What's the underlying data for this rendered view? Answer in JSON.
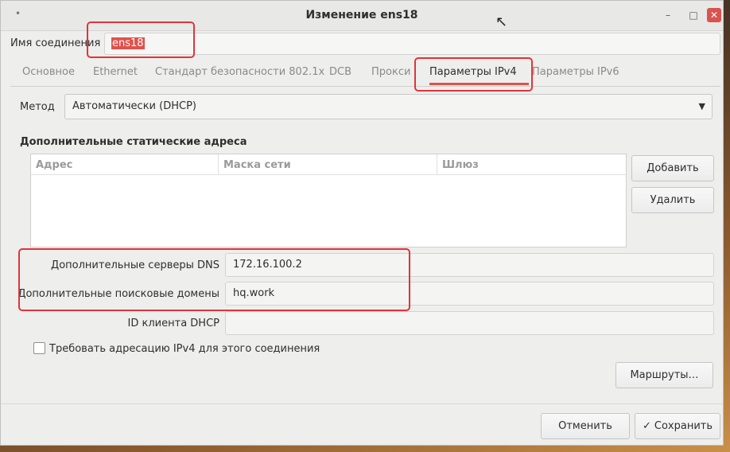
{
  "window": {
    "title": "Изменение ens18",
    "menu_dot": "•",
    "min": "–",
    "max": "□",
    "close": "✕"
  },
  "connection": {
    "label": "Имя соединения",
    "value": "ens18"
  },
  "tabs": [
    {
      "label": "Основное",
      "active": false
    },
    {
      "label": "Ethernet",
      "active": false
    },
    {
      "label": "Стандарт безопасности 802.1x",
      "active": false
    },
    {
      "label": "DCB",
      "active": false
    },
    {
      "label": "Прокси",
      "active": false
    },
    {
      "label": "Параметры IPv4",
      "active": true
    },
    {
      "label": "Параметры IPv6",
      "active": false
    }
  ],
  "method": {
    "label": "Метод",
    "value": "Автоматически (DHCP)"
  },
  "static": {
    "title": "Дополнительные статические адреса",
    "columns": [
      "Адрес",
      "Маска сети",
      "Шлюз"
    ],
    "add_label": "Добавить",
    "delete_label": "Удалить"
  },
  "dns": {
    "label": "Дополнительные серверы DNS",
    "value": "172.16.100.2"
  },
  "domains": {
    "label": "Дополнительные поисковые домены",
    "value": "hq.work"
  },
  "dhcp_client": {
    "label": "ID клиента DHCP",
    "value": ""
  },
  "require_ipv4": {
    "label": "Требовать адресацию IPv4 для этого соединения",
    "checked": false
  },
  "routes_label": "Маршруты…",
  "cancel_label": "Отменить",
  "save_label": "Сохранить",
  "colors": {
    "accent": "#e0524a",
    "annotation": "#e0343a"
  }
}
